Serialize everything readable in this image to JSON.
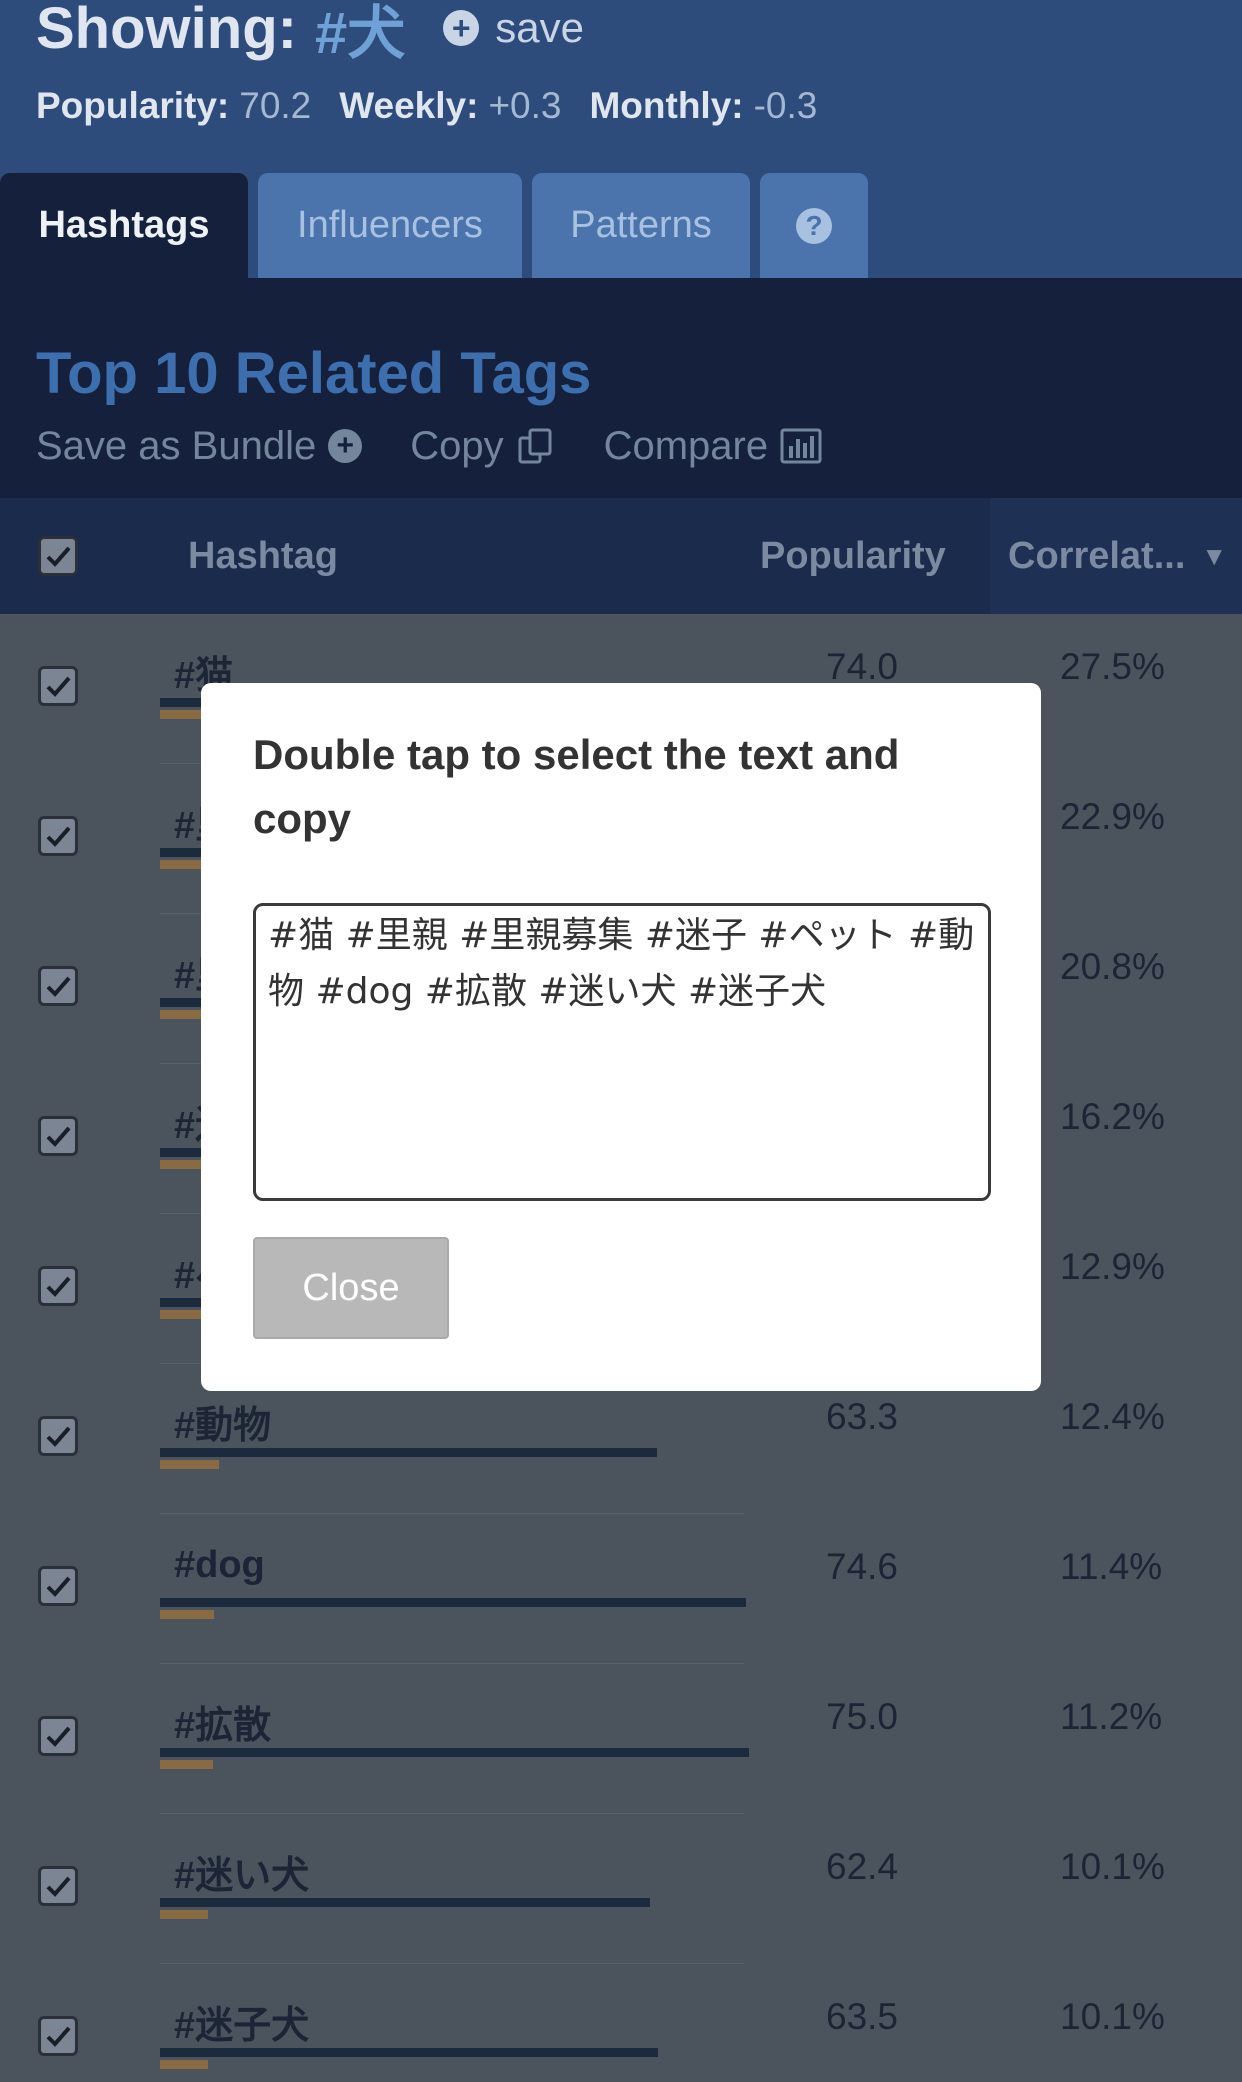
{
  "header": {
    "showing_label": "Showing:",
    "tag": "#犬",
    "save_label": "save",
    "stats": [
      {
        "label": "Popularity:",
        "value": "70.2"
      },
      {
        "label": "Weekly:",
        "value": "+0.3"
      },
      {
        "label": "Monthly:",
        "value": "-0.3"
      }
    ]
  },
  "tabs": [
    {
      "label": "Hashtags",
      "active": true
    },
    {
      "label": "Influencers"
    },
    {
      "label": "Patterns"
    },
    {
      "label": "",
      "icon": "question-circle-icon"
    }
  ],
  "top_section": {
    "title": "Top 10 Related Tags",
    "actions": [
      {
        "label": "Save as Bundle",
        "icon": "plus-circle-icon"
      },
      {
        "label": "Copy",
        "icon": "copy-icon"
      },
      {
        "label": "Compare",
        "icon": "bar-chart-icon"
      }
    ]
  },
  "table": {
    "headers": {
      "hashtag": "Hashtag",
      "popularity": "Popularity",
      "correlation": "Correlat..."
    },
    "rows": [
      {
        "tag": "#猫",
        "popularity": "74.0",
        "correlation": "27.5%",
        "pop_value": 74.0,
        "corr_value": 27.5
      },
      {
        "tag": "#里親",
        "popularity": "",
        "correlation": "22.9%",
        "pop_value": 70,
        "corr_value": 22.9
      },
      {
        "tag": "#里親募集",
        "popularity": "",
        "correlation": "20.8%",
        "pop_value": 68,
        "corr_value": 20.8
      },
      {
        "tag": "#迷子",
        "popularity": "",
        "correlation": "16.2%",
        "pop_value": 67,
        "corr_value": 16.2
      },
      {
        "tag": "#ペット",
        "popularity": "",
        "correlation": "12.9%",
        "pop_value": 72,
        "corr_value": 12.9
      },
      {
        "tag": "#動物",
        "popularity": "63.3",
        "correlation": "12.4%",
        "pop_value": 63.3,
        "corr_value": 12.4
      },
      {
        "tag": "#dog",
        "popularity": "74.6",
        "correlation": "11.4%",
        "pop_value": 74.6,
        "corr_value": 11.4
      },
      {
        "tag": "#拡散",
        "popularity": "75.0",
        "correlation": "11.2%",
        "pop_value": 75.0,
        "corr_value": 11.2
      },
      {
        "tag": "#迷い犬",
        "popularity": "62.4",
        "correlation": "10.1%",
        "pop_value": 62.4,
        "corr_value": 10.1
      },
      {
        "tag": "#迷子犬",
        "popularity": "63.5",
        "correlation": "10.1%",
        "pop_value": 63.5,
        "corr_value": 10.1
      }
    ]
  },
  "modal": {
    "title": "Double tap to select the text and copy",
    "text": " #猫 #里親 #里親募集 #迷子 #ペット #動物 #dog #拡散 #迷い犬 #迷子犬",
    "close_label": "Close"
  }
}
